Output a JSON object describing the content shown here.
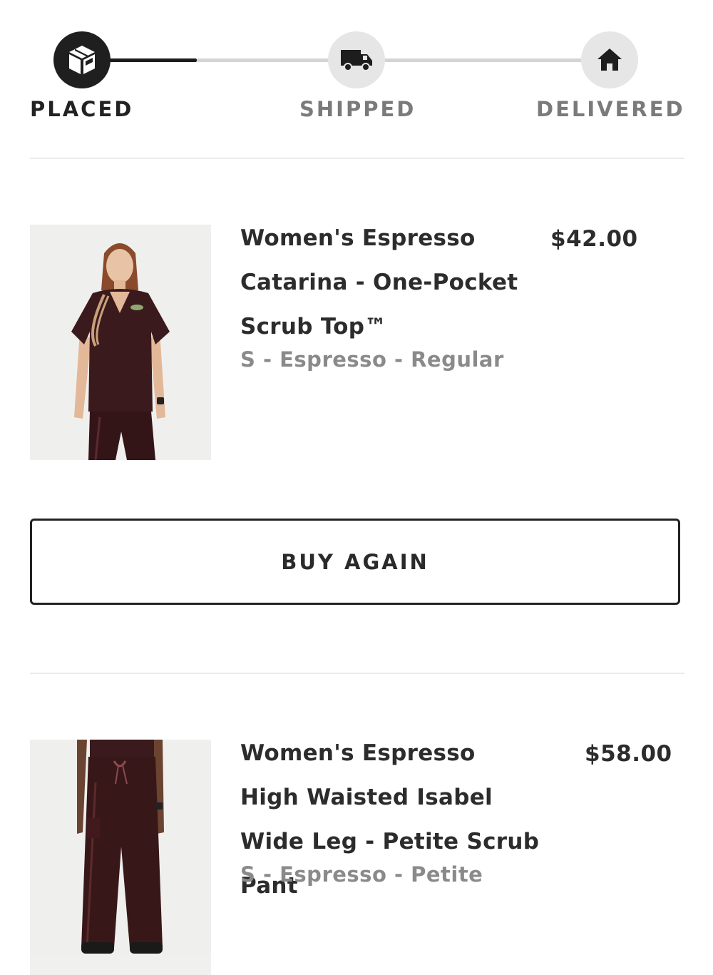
{
  "tracker": {
    "steps": [
      {
        "label": "PLACED",
        "state": "complete",
        "icon": "package-icon"
      },
      {
        "label": "SHIPPED",
        "state": "pending",
        "icon": "truck-icon"
      },
      {
        "label": "DELIVERED",
        "state": "pending",
        "icon": "house-icon"
      }
    ]
  },
  "items": [
    {
      "name": "Women's Espresso Catarina - One-Pocket Scrub Top™",
      "price": "$42.00",
      "variant": "S - Espresso - Regular",
      "image": "product-photo-scrub-top"
    },
    {
      "name": "Women's Espresso High Waisted Isabel Wide Leg - Petite Scrub Pant",
      "price": "$58.00",
      "variant": "S - Espresso - Petite",
      "image": "product-photo-scrub-pant"
    }
  ],
  "actions": {
    "buy_again": "BUY AGAIN"
  },
  "colors": {
    "product": "#3a1a1c",
    "active_step": "#1f1f1f",
    "inactive_step": "#e6e6e6"
  }
}
